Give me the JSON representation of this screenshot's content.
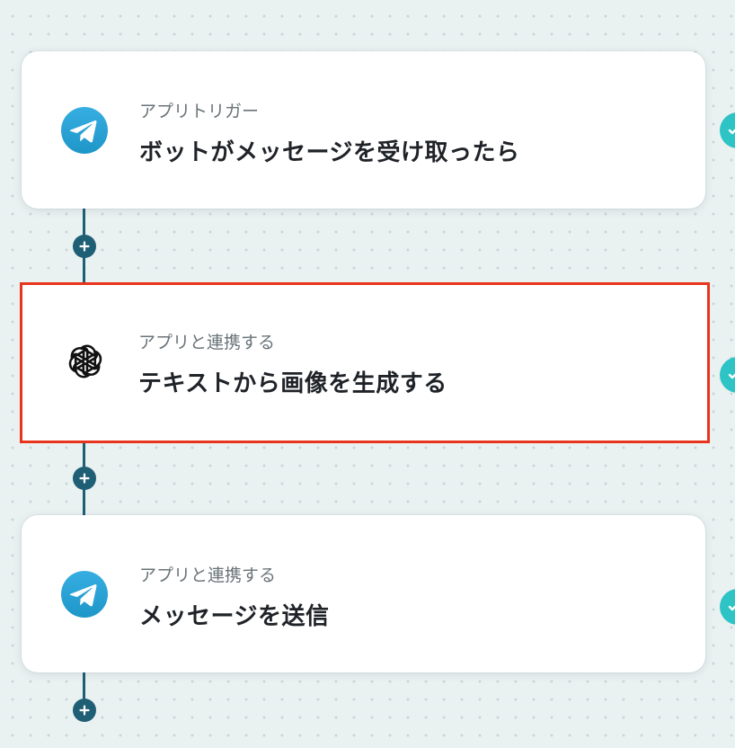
{
  "flow": {
    "steps": [
      {
        "label": "アプリトリガー",
        "title": "ボットがメッセージを受け取ったら",
        "icon": "telegram-icon"
      },
      {
        "label": "アプリと連携する",
        "title": "テキストから画像を生成する",
        "icon": "openai-icon",
        "selected": true
      },
      {
        "label": "アプリと連携する",
        "title": "メッセージを送信",
        "icon": "telegram-icon"
      }
    ]
  },
  "colors": {
    "background": "#eaf1f1",
    "connector": "#1f5f75",
    "telegram_blue": "#2aa3e0",
    "status_teal": "#2ec4c6",
    "selection_red": "#e8341c"
  },
  "icons": {
    "add_step": "plus-icon",
    "status": "check-circle-icon"
  }
}
